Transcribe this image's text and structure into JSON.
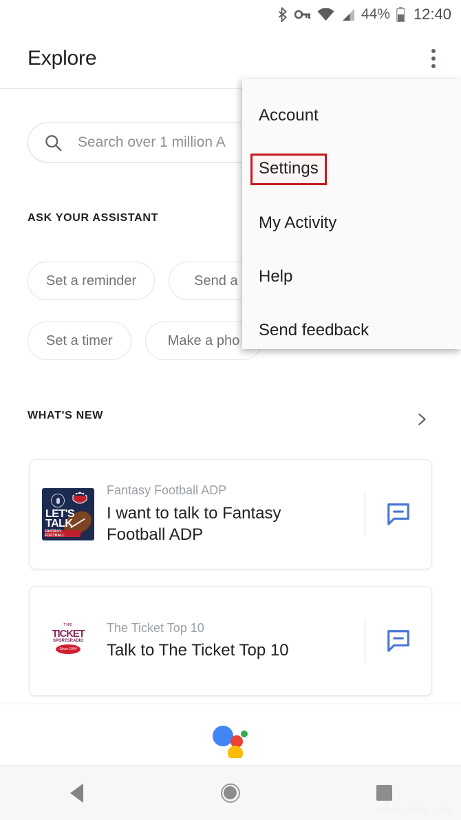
{
  "status_bar": {
    "icons": [
      "bluetooth-icon",
      "vpn-key-icon",
      "wifi-icon",
      "cellular-signal-icon",
      "battery-icon"
    ],
    "battery_percent": "44%",
    "time": "12:40"
  },
  "app_bar": {
    "title": "Explore",
    "overflow_icon": "more-vert-icon"
  },
  "search": {
    "icon": "search-icon",
    "placeholder": "Search over 1 million A"
  },
  "ask_assistant": {
    "heading": "ASK YOUR ASSISTANT",
    "chips_row1": [
      "Set a reminder",
      "Send a"
    ],
    "chips_row2": [
      "Set a timer",
      "Make a pho"
    ]
  },
  "whats_new": {
    "heading": "WHAT'S NEW",
    "chevron_icon": "chevron-right-icon",
    "cards": [
      {
        "subtitle": "Fantasy Football ADP",
        "title": "I want to talk to Fantasy Football ADP",
        "thumbnail_alt": "lets-talk-fantasy-football-thumbnail",
        "thumb_line1": "LET'S",
        "thumb_line2": "TALK",
        "thumb_banner": "FANTASY FOOTBALL",
        "action_icon": "message-bubble-icon"
      },
      {
        "subtitle": "The Ticket Top 10",
        "title": "Talk to The Ticket Top 10",
        "thumbnail_alt": "the-ticket-top-10-thumbnail",
        "thumb_the": "THE",
        "thumb_word": "TICKET",
        "thumb_sub": "SPORTSRADIO",
        "thumb_oval": "Since 1994",
        "action_icon": "message-bubble-icon"
      }
    ]
  },
  "assistant_logo": {
    "name": "google-assistant-logo",
    "colors": {
      "blue": "#4285F4",
      "red": "#EA4335",
      "yellow": "#FBBC05",
      "green": "#34A853"
    }
  },
  "overflow_menu": {
    "items": [
      {
        "label": "Account",
        "highlighted": false
      },
      {
        "label": "Settings",
        "highlighted": true
      },
      {
        "label": "My Activity",
        "highlighted": false
      },
      {
        "label": "Help",
        "highlighted": false
      },
      {
        "label": "Send feedback",
        "highlighted": false
      }
    ],
    "highlight_color": "#c5181f"
  },
  "nav_bar": {
    "back": "back-triangle-icon",
    "home": "home-circle-icon",
    "recents": "recents-square-icon"
  },
  "watermark": "www.irfam.com"
}
